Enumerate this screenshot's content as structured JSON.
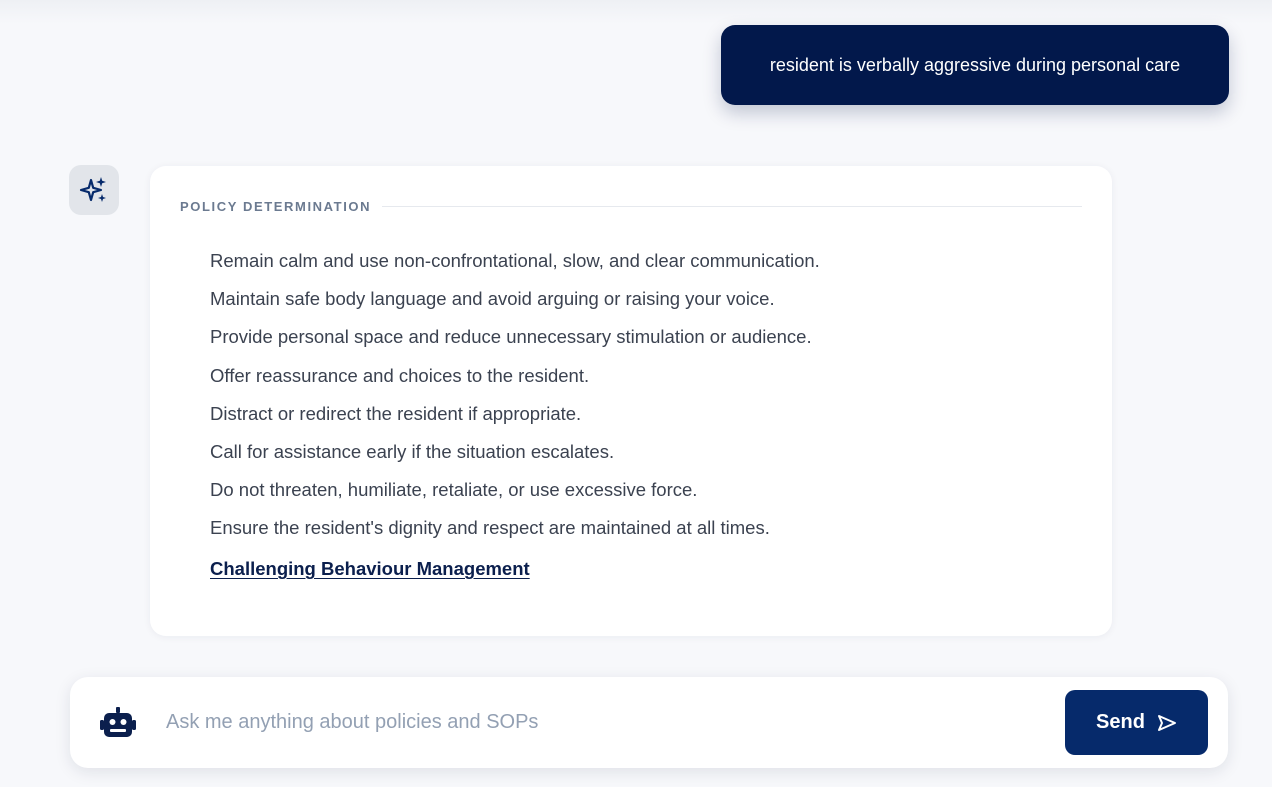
{
  "conversation": {
    "user_message": "resident is verbally aggressive during personal care",
    "response": {
      "heading": "POLICY DETERMINATION",
      "items": [
        "Remain calm and use non-confrontational, slow, and clear communication.",
        "Maintain safe body language and avoid arguing or raising your voice.",
        "Provide personal space and reduce unnecessary stimulation or audience.",
        "Offer reassurance and choices to the resident.",
        "Distract or redirect the resident if appropriate.",
        "Call for assistance early if the situation escalates.",
        "Do not threaten, humiliate, retaliate, or use excessive force.",
        "Ensure the resident's dignity and respect are maintained at all times."
      ],
      "link_label": "Challenging Behaviour Management"
    }
  },
  "composer": {
    "placeholder": "Ask me anything about policies and SOPs",
    "value": "",
    "send_label": "Send"
  },
  "icons": {
    "assistant_avatar": "sparkles-icon",
    "composer_avatar": "robot-icon",
    "send": "send-arrow-icon"
  },
  "colors": {
    "accent": "#02184b",
    "send_button": "#062a6b",
    "page_background": "#f7f8fb",
    "card_background": "#ffffff",
    "heading_text": "#6b7a90"
  }
}
